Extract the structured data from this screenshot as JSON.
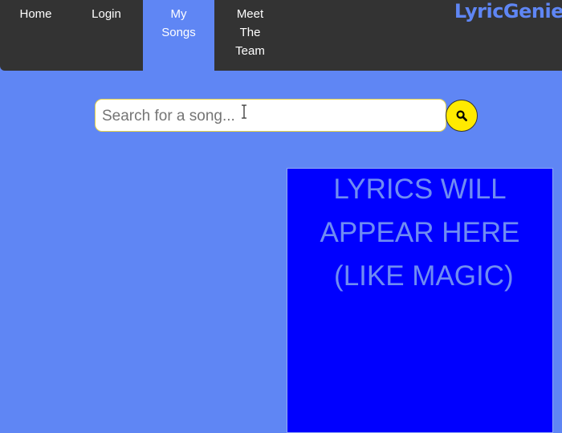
{
  "nav": {
    "items": [
      {
        "label": "Home",
        "active": false
      },
      {
        "label": "Login",
        "active": false
      },
      {
        "label": "My\nSongs",
        "active": true
      },
      {
        "label": "Meet\nThe\nTeam",
        "active": false
      }
    ],
    "logo": "LyricGenie"
  },
  "search": {
    "value": "",
    "placeholder": "Search for a song...",
    "button_icon": "search-icon"
  },
  "lyrics": {
    "lines": [
      "LYRICS WILL",
      "APPEAR HERE",
      " (LIKE MAGIC)"
    ]
  },
  "colors": {
    "page_background": "#5f86f4",
    "nav_background": "#333333",
    "search_button": "#ffea00",
    "lyrics_background": "#0000ff",
    "lyrics_text": "#6f8cf2"
  }
}
